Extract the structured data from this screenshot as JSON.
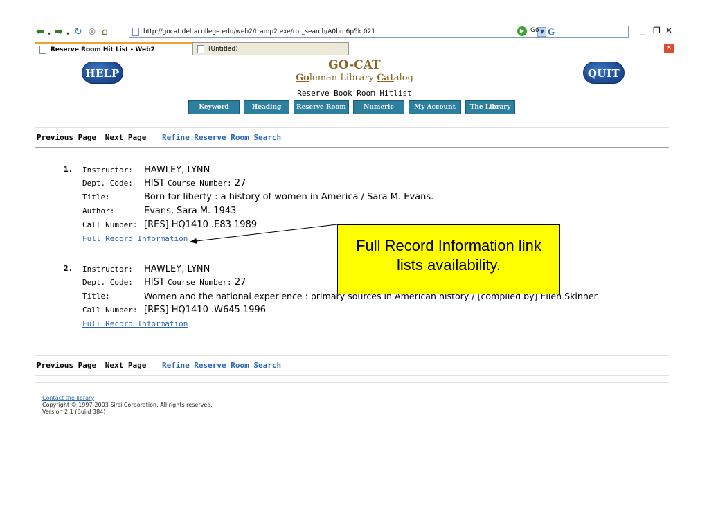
{
  "browser": {
    "url": "http://gocat.deltacollege.edu/web2/tramp2.exe/rbr_search/A0bm6p5k.021",
    "go_label": "Go",
    "search_logo": "G",
    "win_minimize": "_",
    "win_restore": "&#x2750;",
    "win_close": "✕",
    "tabs": [
      {
        "label": "Reserve Room Hit List - Web2"
      },
      {
        "label": "(Untitled)"
      }
    ],
    "tab_close": "✕"
  },
  "header": {
    "help_label": "HELP",
    "quit_label": "QUIT",
    "title": "GO-CAT",
    "subtitle_parts": [
      "Go",
      "leman Library ",
      "Cat",
      "alog"
    ],
    "page_heading": "Reserve Book Room Hitlist",
    "nav_tabs": [
      "Keyword",
      "Heading",
      "Reserve Room",
      "Numeric",
      "My Account",
      "The Library"
    ]
  },
  "nav": {
    "previous": "Previous Page",
    "next": "Next Page",
    "refine": "Refine Reserve Room Search"
  },
  "labels": {
    "instructor": "Instructor:",
    "dept": "Dept. Code:",
    "course": "Course Number:",
    "title": "Title:",
    "author": "Author:",
    "call": "Call Number:",
    "full_record": "Full Record Information"
  },
  "results": [
    {
      "num": "1.",
      "instructor": "HAWLEY, LYNN",
      "dept": "HIST",
      "course": "27",
      "title": "Born for liberty : a history of women in America / Sara M. Evans.",
      "author": "Evans, Sara M. 1943-",
      "call": "[RES] HQ1410 .E83 1989"
    },
    {
      "num": "2.",
      "instructor": "HAWLEY, LYNN",
      "dept": "HIST",
      "course": "27",
      "title": "Women and the national experience : primary sources in American history / [compiled by] Ellen Skinner.",
      "call": "[RES] HQ1410 .W645 1996"
    }
  ],
  "callout": {
    "line1": "Full Record Information link",
    "line2": "lists availability."
  },
  "footer": {
    "contact": "Contact the library",
    "copyright": "Copyright © 1997-2003 Sirsi Corporation. All rights reserved.",
    "version": "Version 2.1 (Build 384)"
  }
}
